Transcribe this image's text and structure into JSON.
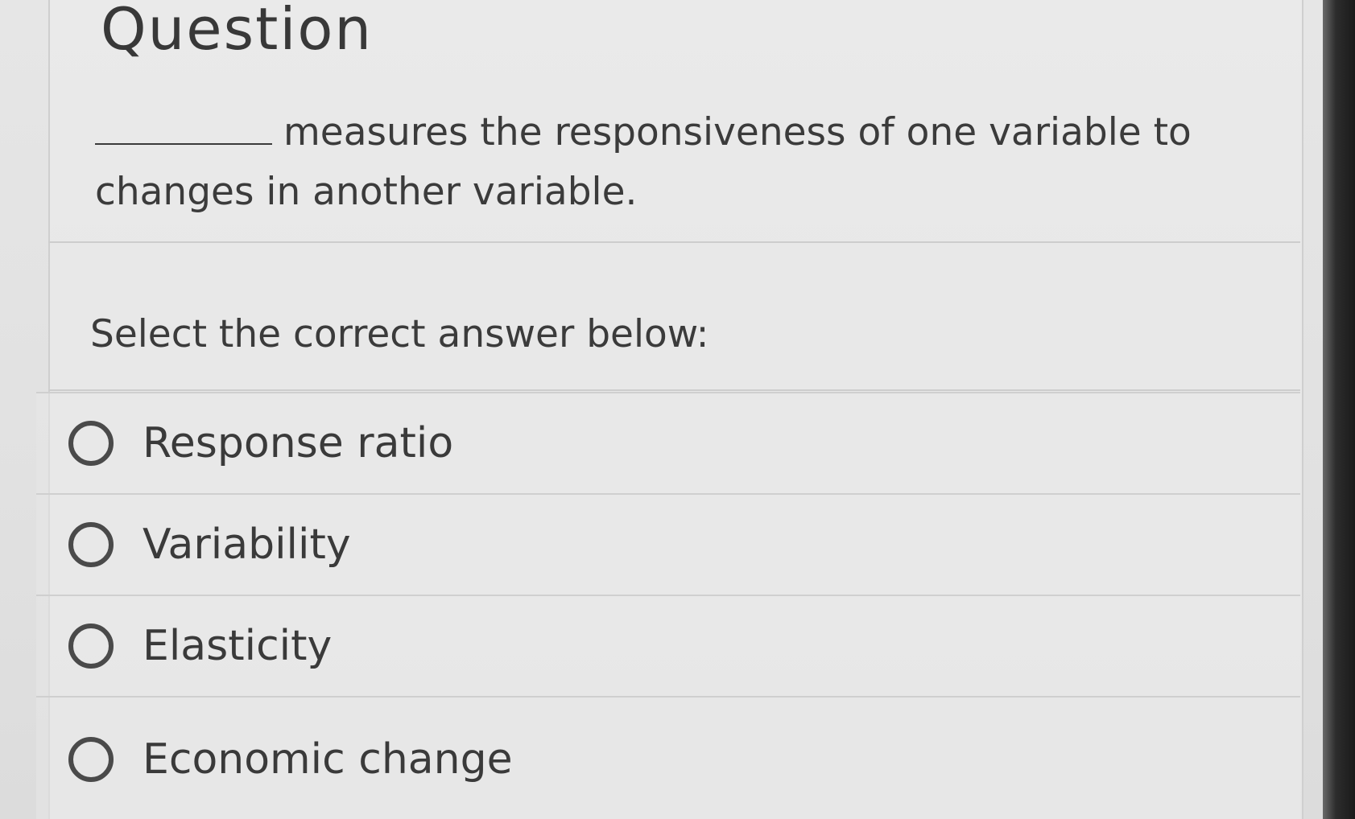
{
  "question": {
    "heading": "Question",
    "prompt": "measures the responsiveness of one variable to changes in another variable."
  },
  "instruction": "Select the correct answer below:",
  "options": [
    {
      "label": "Response ratio",
      "selected": false
    },
    {
      "label": "Variability",
      "selected": false
    },
    {
      "label": "Elasticity",
      "selected": false
    },
    {
      "label": "Economic change",
      "selected": false
    }
  ],
  "colors": {
    "text": "#3a3a3a",
    "background": "#e3e3e3",
    "border": "#cfcfcf"
  }
}
